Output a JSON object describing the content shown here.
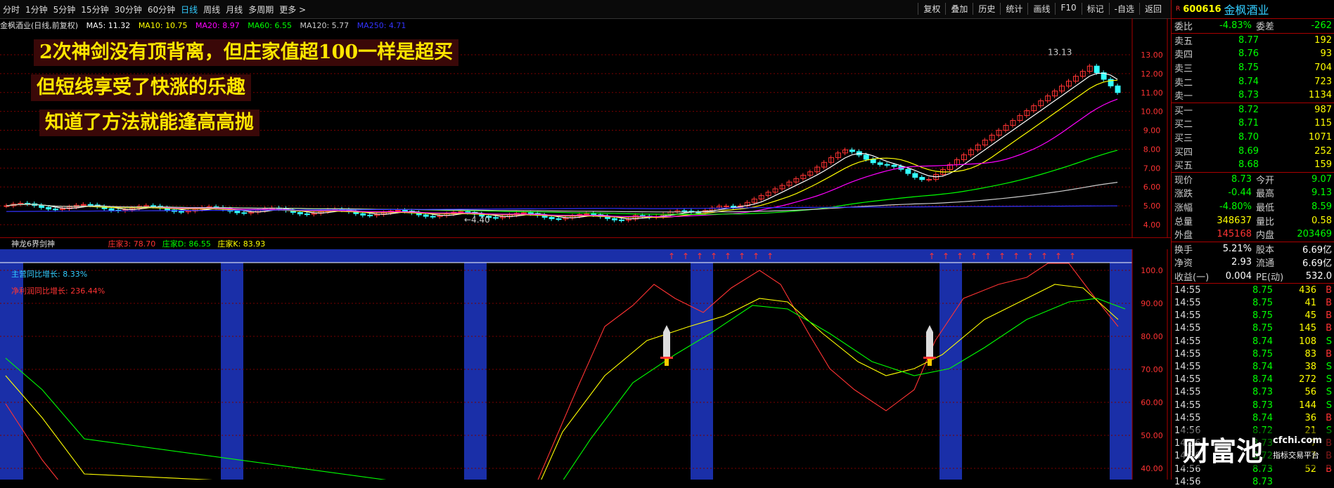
{
  "toolbar": {
    "periods": [
      "分时",
      "1分钟",
      "5分钟",
      "15分钟",
      "30分钟",
      "60分钟",
      "日线",
      "周线",
      "月线",
      "多周期",
      "更多 >"
    ],
    "active_period": "日线",
    "right_buttons": [
      "复权",
      "叠加",
      "历史",
      "统计",
      "画线",
      "F10",
      "标记",
      "-自选",
      "返回"
    ]
  },
  "kline_header": {
    "title": "金枫酒业(日线,前复权)",
    "ma5": "MA5: 11.32",
    "ma10": "MA10: 10.75",
    "ma20": "MA20: 8.97",
    "ma60": "MA60: 6.55",
    "ma120": "MA120: 5.77",
    "ma250": "MA250: 4.71"
  },
  "annotations": {
    "line1": "2次神剑没有顶背离，但庄家值超100一样是超买",
    "line2": "但短线享受了快涨的乐趣",
    "line3": "知道了方法就能逢高高抛",
    "high_label": "13.13",
    "low_label": "←4.40"
  },
  "price_axis": [
    "13.00",
    "12.00",
    "11.00",
    "10.00",
    "9.00",
    "8.00",
    "7.00",
    "6.00",
    "5.00",
    "4.00"
  ],
  "sub_header": {
    "name": "神龙6界剑神",
    "z3": "庄家3: 78.70",
    "zd": "庄家D: 86.55",
    "zk": "庄家K: 83.93",
    "yoy_rev": "主营同比增长: 8.33%",
    "yoy_profit": "净利润同比增长: 236.44%"
  },
  "sub_axis": [
    "100.0",
    "90.00",
    "80.00",
    "70.00",
    "60.00",
    "50.00",
    "40.00"
  ],
  "quote": {
    "code": "600616",
    "name": "金枫酒业",
    "weibi_label": "委比",
    "weibi": "-4.83%",
    "weicha_label": "委差",
    "weicha": "-262",
    "asks": [
      {
        "label": "卖五",
        "price": "8.77",
        "vol": "192"
      },
      {
        "label": "卖四",
        "price": "8.76",
        "vol": "93"
      },
      {
        "label": "卖三",
        "price": "8.75",
        "vol": "704"
      },
      {
        "label": "卖二",
        "price": "8.74",
        "vol": "723"
      },
      {
        "label": "卖一",
        "price": "8.73",
        "vol": "1134"
      }
    ],
    "bids": [
      {
        "label": "买一",
        "price": "8.72",
        "vol": "987"
      },
      {
        "label": "买二",
        "price": "8.71",
        "vol": "115"
      },
      {
        "label": "买三",
        "price": "8.70",
        "vol": "1071"
      },
      {
        "label": "买四",
        "price": "8.69",
        "vol": "252"
      },
      {
        "label": "买五",
        "price": "8.68",
        "vol": "159"
      }
    ],
    "stats": [
      {
        "l1": "现价",
        "v1": "8.73",
        "l2": "今开",
        "v2": "9.07",
        "c1": "g",
        "c2": "g"
      },
      {
        "l1": "涨跌",
        "v1": "-0.44",
        "l2": "最高",
        "v2": "9.13",
        "c1": "g",
        "c2": "g"
      },
      {
        "l1": "涨幅",
        "v1": "-4.80%",
        "l2": "最低",
        "v2": "8.59",
        "c1": "g",
        "c2": "g"
      },
      {
        "l1": "总量",
        "v1": "348637",
        "l2": "量比",
        "v2": "0.58",
        "c1": "y",
        "c2": "y"
      },
      {
        "l1": "外盘",
        "v1": "145168",
        "l2": "内盘",
        "v2": "203469",
        "c1": "r",
        "c2": "g"
      }
    ],
    "stats2": [
      {
        "l1": "换手",
        "v1": "5.21%",
        "l2": "股本",
        "v2": "6.69亿"
      },
      {
        "l1": "净资",
        "v1": "2.93",
        "l2": "流通",
        "v2": "6.69亿"
      },
      {
        "l1": "收益(一)",
        "v1": "0.004",
        "l2": "PE(动)",
        "v2": "532.0"
      }
    ],
    "ticks": [
      {
        "t": "14:55",
        "p": "8.75",
        "v": "436",
        "d": "B"
      },
      {
        "t": "14:55",
        "p": "8.75",
        "v": "41",
        "d": "B"
      },
      {
        "t": "14:55",
        "p": "8.75",
        "v": "45",
        "d": "B"
      },
      {
        "t": "14:55",
        "p": "8.75",
        "v": "145",
        "d": "B"
      },
      {
        "t": "14:55",
        "p": "8.74",
        "v": "108",
        "d": "S"
      },
      {
        "t": "14:55",
        "p": "8.75",
        "v": "83",
        "d": "B"
      },
      {
        "t": "14:55",
        "p": "8.74",
        "v": "38",
        "d": "S"
      },
      {
        "t": "14:55",
        "p": "8.74",
        "v": "272",
        "d": "S"
      },
      {
        "t": "14:55",
        "p": "8.73",
        "v": "56",
        "d": "S"
      },
      {
        "t": "14:55",
        "p": "8.73",
        "v": "144",
        "d": "S"
      },
      {
        "t": "14:55",
        "p": "8.74",
        "v": "36",
        "d": "B"
      },
      {
        "t": "14:56",
        "p": "8.72",
        "v": "21",
        "d": "S"
      },
      {
        "t": "14:56",
        "p": "8.73",
        "v": "7",
        "d": "B"
      },
      {
        "t": "14:56",
        "p": "8.72",
        "v": "7",
        "d": "B"
      },
      {
        "t": "14:56",
        "p": "8.73",
        "v": "52",
        "d": "B"
      },
      {
        "t": "14:56",
        "p": "8.73",
        "v": "",
        "d": ""
      }
    ]
  },
  "logo": {
    "text": "财富池",
    "url": "cfchi.com",
    "sub": "指标交易平台"
  }
}
